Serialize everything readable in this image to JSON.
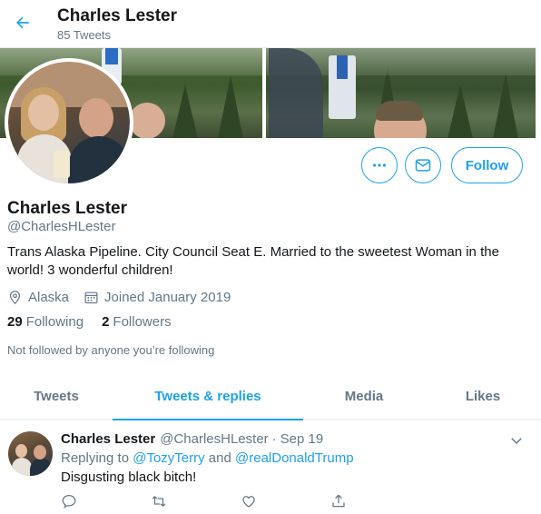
{
  "header": {
    "title": "Charles Lester",
    "subtitle": "85 Tweets"
  },
  "profile": {
    "name": "Charles Lester",
    "handle": "@CharlesHLester",
    "bio": "Trans Alaska Pipeline. City Council Seat E. Married to the sweetest Woman in the world! 3 wonderful children!",
    "location": "Alaska",
    "joined": "Joined January 2019",
    "following_count": "29",
    "following_label": "Following",
    "followers_count": "2",
    "followers_label": "Followers",
    "not_followed": "Not followed by anyone you’re following"
  },
  "actions": {
    "follow_label": "Follow",
    "more_icon": "more-icon",
    "message_icon": "message-icon"
  },
  "tabs": [
    {
      "label": "Tweets",
      "active": false
    },
    {
      "label": "Tweets & replies",
      "active": true
    },
    {
      "label": "Media",
      "active": false
    },
    {
      "label": "Likes",
      "active": false
    }
  ],
  "tweet": {
    "name": "Charles Lester",
    "handle": "@CharlesHLester",
    "separator": "·",
    "date": "Sep 19",
    "replying_prefix": "Replying to ",
    "mention_1": "@TozyTerry",
    "and_word": " and ",
    "mention_2": "@realDonaldTrump",
    "text": "Disgusting black bitch!"
  },
  "colors": {
    "accent": "#1da1f2",
    "secondary_text": "#657786",
    "primary_text": "#14171a"
  }
}
